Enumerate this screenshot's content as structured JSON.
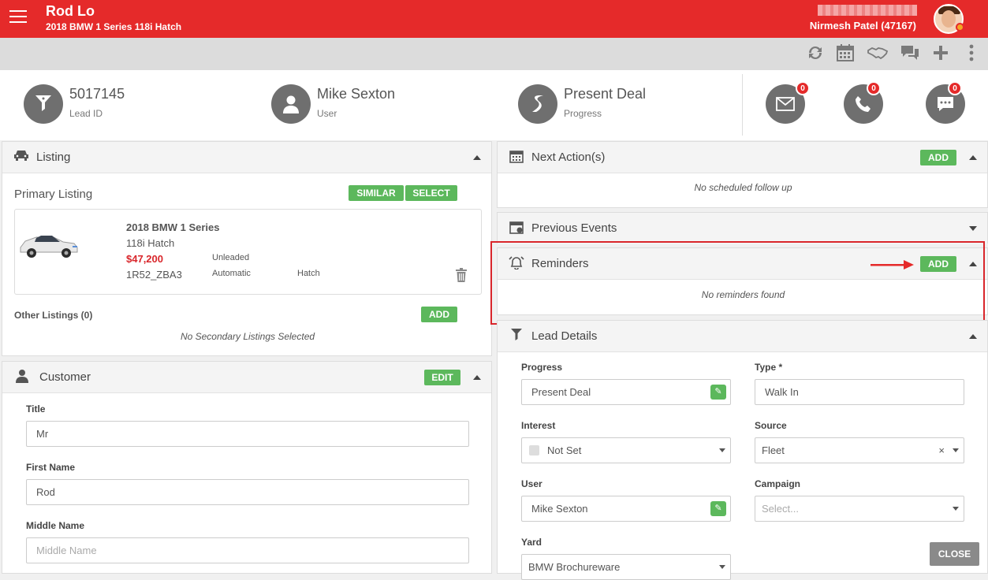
{
  "header": {
    "lead_name": "Rod Lo",
    "vehicle": "2018 BMW 1 Series 118i Hatch",
    "user_display": "Nirmesh Patel (47167)"
  },
  "toolbar": {
    "icons": [
      "refresh-icon",
      "calendar-icon",
      "handshake-icon",
      "chat-icon",
      "plus-icon",
      "more-vertical-icon"
    ]
  },
  "summary": {
    "lead_id": {
      "value": "5017145",
      "label": "Lead ID"
    },
    "user": {
      "value": "Mike Sexton",
      "label": "User"
    },
    "progress": {
      "value": "Present Deal",
      "label": "Progress"
    },
    "email_count": "0",
    "phone_count": "0",
    "sms_count": "0"
  },
  "listing": {
    "title": "Listing",
    "primary_label": "Primary Listing",
    "similar_label": "SIMILAR",
    "select_label": "SELECT",
    "car": {
      "name": "2018 BMW 1 Series",
      "variant": "118i Hatch",
      "price": "$47,200",
      "stock": "1R52_ZBA3",
      "fuel": "Unleaded",
      "transmission": "Automatic",
      "body": "Hatch"
    },
    "other_label": "Other Listings (0)",
    "add_label": "ADD",
    "empty_note": "No Secondary Listings Selected"
  },
  "customer": {
    "title": "Customer",
    "edit_label": "EDIT",
    "fields": {
      "title_label": "Title",
      "title_value": "Mr",
      "first_name_label": "First Name",
      "first_name_value": "Rod",
      "middle_name_label": "Middle Name",
      "middle_name_placeholder": "Middle Name"
    }
  },
  "next_actions": {
    "title": "Next Action(s)",
    "add_label": "ADD",
    "empty_note": "No scheduled follow up"
  },
  "previous_events": {
    "title": "Previous Events"
  },
  "reminders": {
    "title": "Reminders",
    "add_label": "ADD",
    "empty_note": "No reminders found"
  },
  "lead_details": {
    "title": "Lead Details",
    "progress_label": "Progress",
    "progress_value": "Present Deal",
    "type_label": "Type *",
    "type_value": "Walk In",
    "interest_label": "Interest",
    "interest_value": "Not Set",
    "source_label": "Source",
    "source_value": "Fleet",
    "source_clear": "×",
    "user_label": "User",
    "user_value": "Mike Sexton",
    "campaign_label": "Campaign",
    "campaign_placeholder": "Select...",
    "yard_label": "Yard",
    "yard_value": "BMW Brochureware"
  },
  "close_label": "CLOSE",
  "colors": {
    "brand": "#e52a2a",
    "green": "#5cb85c",
    "price": "#d9262b"
  }
}
